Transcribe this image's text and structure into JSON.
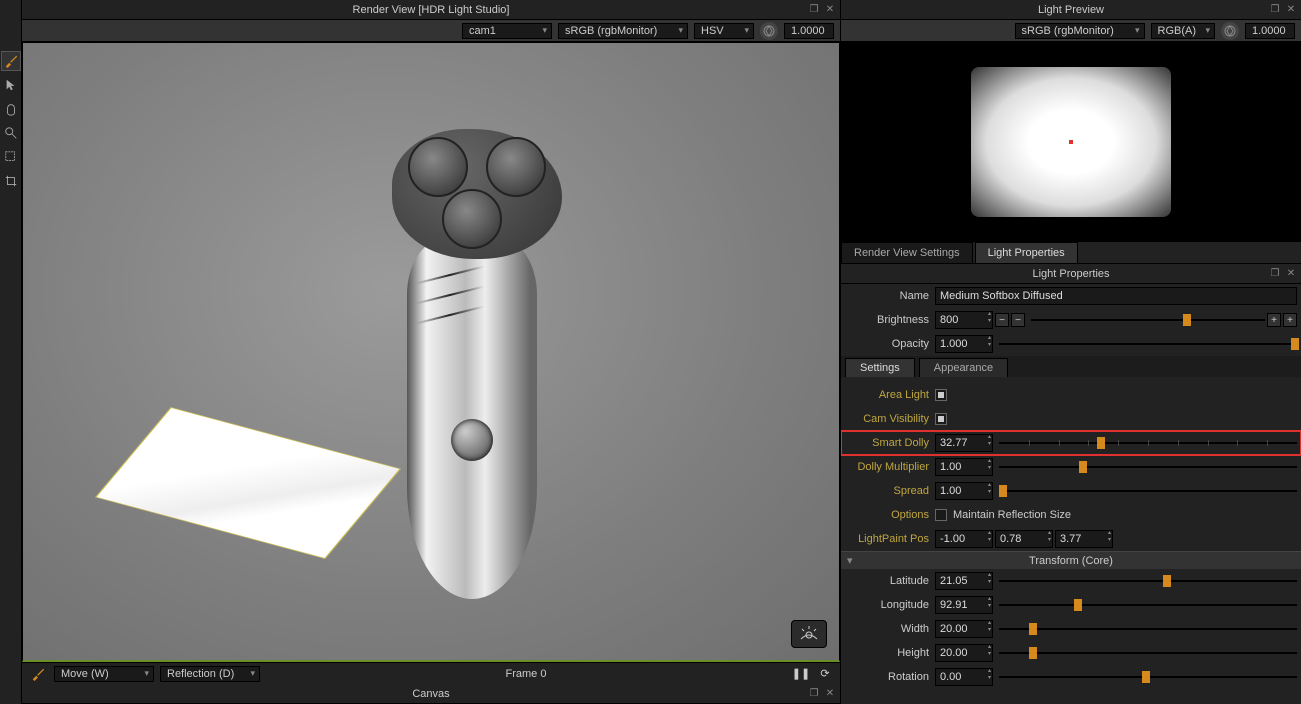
{
  "renderView": {
    "title": "Render View [HDR Light Studio]",
    "camera": "cam1",
    "colorSpace": "sRGB (rgbMonitor)",
    "colorModel": "HSV",
    "exposure": "1.0000"
  },
  "statusBar": {
    "tool": "Move (W)",
    "mode": "Reflection (D)",
    "frame": "Frame 0",
    "canvas": "Canvas"
  },
  "lightPreview": {
    "title": "Light Preview",
    "colorSpace": "sRGB (rgbMonitor)",
    "channel": "RGB(A)",
    "exposure": "1.0000"
  },
  "tabs": {
    "renderSettings": "Render View Settings",
    "lightProps": "Light Properties"
  },
  "lightProps": {
    "panelTitle": "Light Properties",
    "labels": {
      "name": "Name",
      "brightness": "Brightness",
      "opacity": "Opacity",
      "areaLight": "Area Light",
      "camVis": "Cam Visibility",
      "smartDolly": "Smart Dolly",
      "dollyMult": "Dolly Multiplier",
      "spread": "Spread",
      "options": "Options",
      "lightPaint": "LightPaint Pos",
      "latitude": "Latitude",
      "longitude": "Longitude",
      "width": "Width",
      "height": "Height",
      "rotation": "Rotation"
    },
    "subTabs": {
      "settings": "Settings",
      "appearance": "Appearance"
    },
    "name": "Medium Softbox Diffused",
    "brightness": "800",
    "opacity": "1.000",
    "smartDolly": "32.77",
    "dollyMult": "1.00",
    "spread": "1.00",
    "maintainRefl": "Maintain Reflection Size",
    "lightPaintPos": {
      "x": "-1.00",
      "y": "0.78",
      "z": "3.77"
    },
    "transformHeader": "Transform (Core)",
    "latitude": "21.05",
    "longitude": "92.91",
    "width": "20.00",
    "height": "20.00",
    "rotation": "0.00"
  }
}
